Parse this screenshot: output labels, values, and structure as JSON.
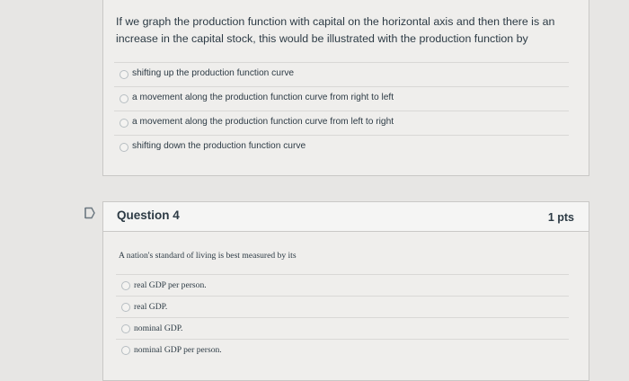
{
  "question3": {
    "text": "If we graph the production function with capital on the horizontal axis and then there is an increase in the capital stock, this would be illustrated with the production function by",
    "answers": [
      "shifting up the production function curve",
      "a movement along the production function curve from right to left",
      "a movement along the production function curve from left to right",
      "shifting down the production function curve"
    ]
  },
  "question4": {
    "title": "Question 4",
    "points": "1 pts",
    "text": "A nation's standard of living is best measured by its",
    "answers": [
      "real GDP per person.",
      "real GDP.",
      "nominal GDP.",
      "nominal GDP per person."
    ]
  },
  "icons": {
    "flag": "flag-icon"
  },
  "colors": {
    "text": "#2d3b45",
    "card_bg": "#efeeec",
    "page_bg": "#e7e6e4"
  }
}
